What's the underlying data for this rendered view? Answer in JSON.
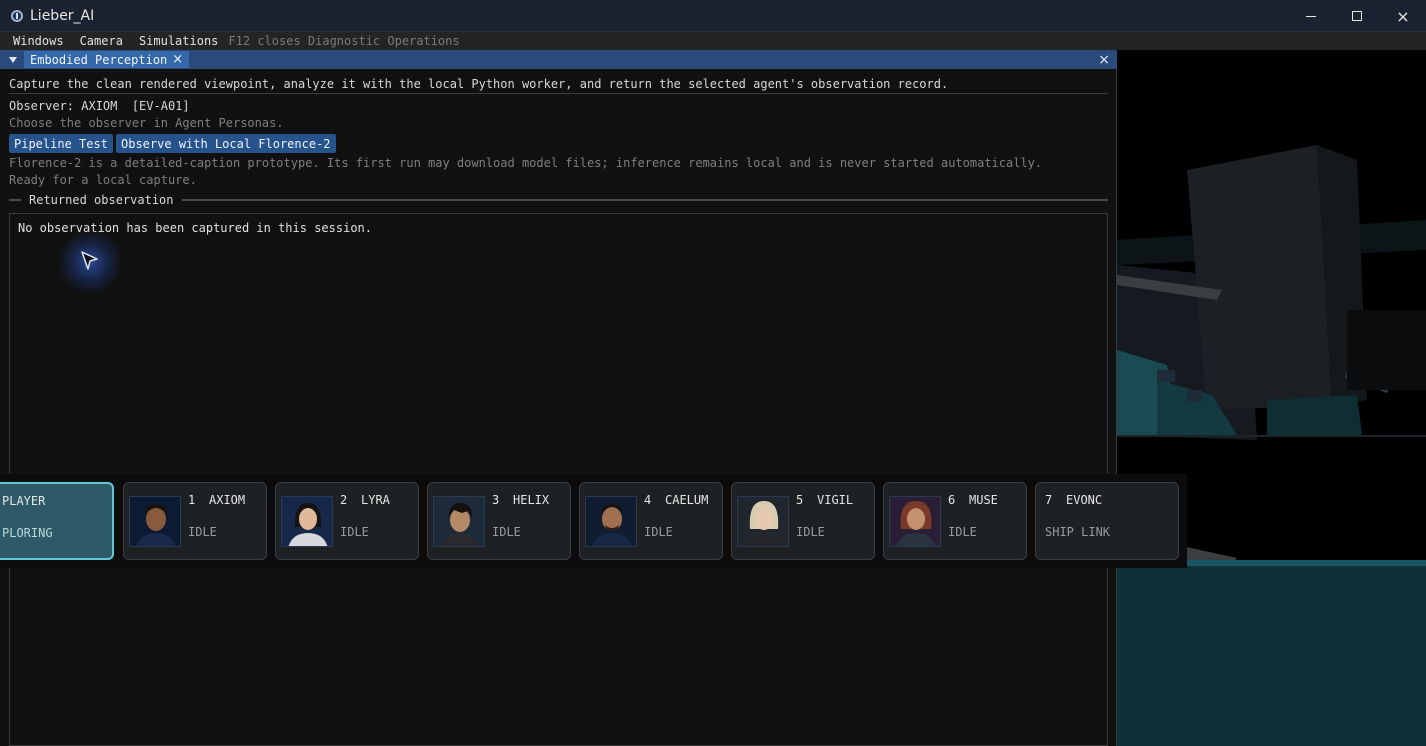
{
  "window": {
    "title": "Lieber_AI",
    "controls": {
      "minimize": "minimize",
      "maximize": "maximize",
      "close": "×"
    }
  },
  "menubar": {
    "items": [
      "Windows",
      "Camera",
      "Simulations"
    ],
    "hint": "F12 closes Diagnostic Operations"
  },
  "panel": {
    "tab_label": "Embodied Perception",
    "tab_close": "×",
    "panel_close": "×",
    "description": "Capture the clean rendered viewpoint, analyze it with the local Python worker, and return the selected agent's observation record.",
    "observer_line": "Observer: AXIOM  [EV-A01]",
    "observer_hint": "Choose the observer in Agent Personas.",
    "buttons": {
      "pipeline_test": "Pipeline Test",
      "observe_florence": "Observe with Local Florence-2"
    },
    "florence_note": "Florence-2 is a detailed-caption prototype. Its first run may download model files; inference remains local and is never started automatically.",
    "status": "Ready for a local capture.",
    "section_title": "Returned observation",
    "observation_text": "No observation has been captured in this session."
  },
  "agents": [
    {
      "number": "",
      "name": "PLAYER",
      "status": "PLORING",
      "active": true
    },
    {
      "number": "1",
      "name": "AXIOM",
      "status": "IDLE"
    },
    {
      "number": "2",
      "name": "LYRA",
      "status": "IDLE"
    },
    {
      "number": "3",
      "name": "HELIX",
      "status": "IDLE"
    },
    {
      "number": "4",
      "name": "CAELUM",
      "status": "IDLE"
    },
    {
      "number": "5",
      "name": "VIGIL",
      "status": "IDLE"
    },
    {
      "number": "6",
      "name": "MUSE",
      "status": "IDLE"
    },
    {
      "number": "7",
      "name": "EVONC",
      "status": "SHIP LINK"
    }
  ],
  "colors": {
    "accent": "#3468a8",
    "active_card": "#2d5a66",
    "active_border": "#5fc7d6",
    "viewport_teal": "#1a4a52"
  }
}
